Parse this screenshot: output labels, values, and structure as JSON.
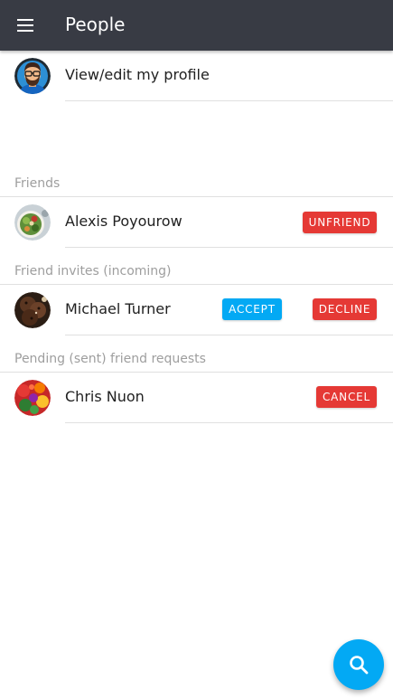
{
  "colors": {
    "appbar_bg": "#383b44",
    "accent_blue": "#03a9f4",
    "danger_red": "#e53935",
    "subheader_text": "#9e9e9e"
  },
  "appbar": {
    "title": "People",
    "menu_icon": "hamburger-menu-icon"
  },
  "profile": {
    "label": "View/edit my profile",
    "avatar": "bearded-man-avatar"
  },
  "sections": {
    "friends": {
      "header": "Friends",
      "items": [
        {
          "name": "Alexis Poyourow",
          "avatar": "salad-bowl-avatar",
          "actions": [
            "UNFRIEND"
          ]
        }
      ]
    },
    "incoming": {
      "header": "Friend invites (incoming)",
      "items": [
        {
          "name": "Michael Turner",
          "avatar": "cookies-avatar",
          "actions": [
            "ACCEPT",
            "DECLINE"
          ]
        }
      ]
    },
    "pending": {
      "header": "Pending (sent) friend requests",
      "items": [
        {
          "name": "Chris Nuon",
          "avatar": "vegetables-avatar",
          "actions": [
            "CANCEL"
          ]
        }
      ]
    }
  },
  "fab": {
    "icon": "search-icon"
  }
}
